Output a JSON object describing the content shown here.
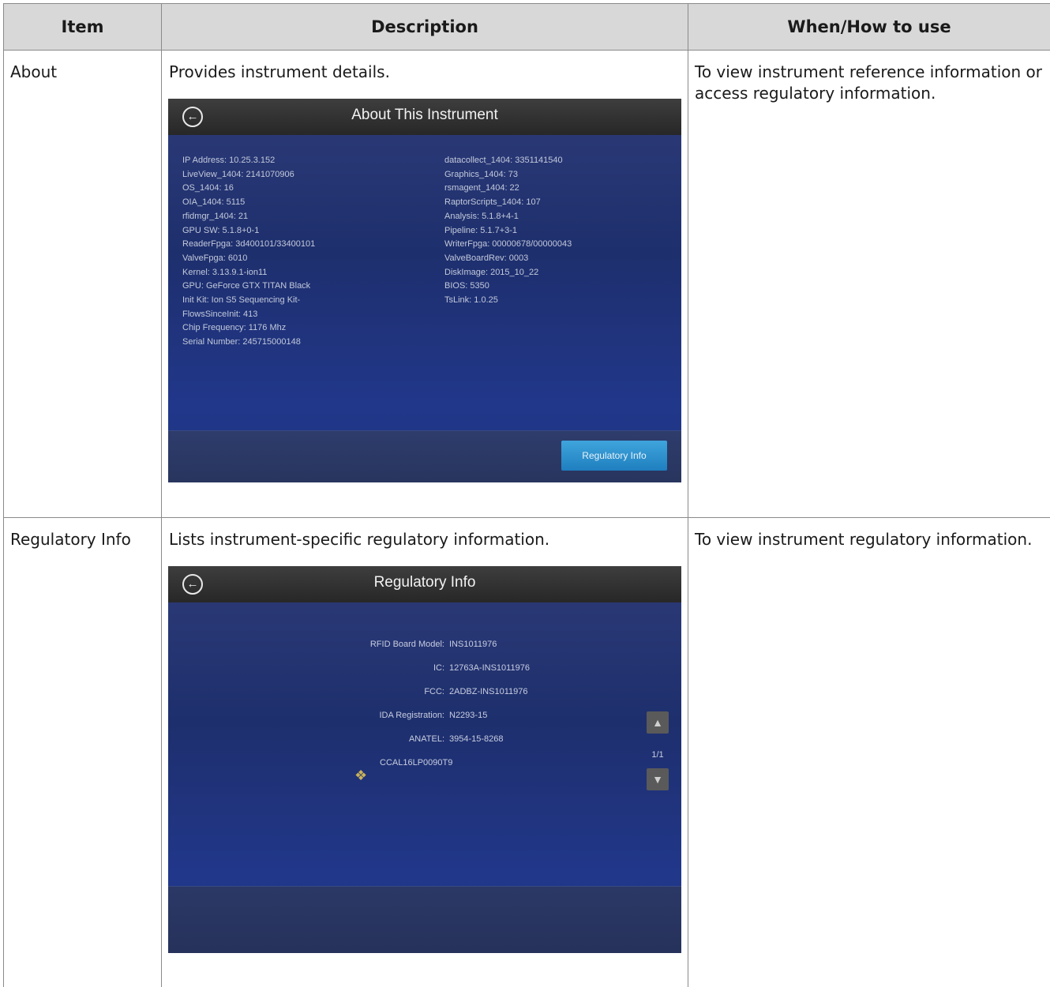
{
  "table": {
    "headers": [
      "Item",
      "Description",
      "When/How to use"
    ],
    "rows": [
      {
        "item": "About",
        "description": "Provides instrument details.",
        "usage": "To view instrument reference information or access regulatory information."
      },
      {
        "item": "Regulatory Info",
        "description": "Lists instrument-specific regulatory information.",
        "usage": "To view instrument regulatory information."
      }
    ]
  },
  "about_screen": {
    "title": "About This Instrument",
    "left_lines": [
      "IP Address: 10.25.3.152",
      "LiveView_1404: 2141070906",
      "OS_1404: 16",
      "OIA_1404: 5115",
      "rfidmgr_1404: 21",
      "GPU SW: 5.1.8+0-1",
      "ReaderFpga: 3d400101/33400101",
      "ValveFpga: 6010",
      "Kernel: 3.13.9.1-ion11",
      "GPU: GeForce GTX TITAN Black",
      "Init Kit: Ion S5 Sequencing Kit-",
      "FlowsSinceInit: 413",
      "Chip Frequency: 1176 Mhz",
      "Serial Number: 245715000148"
    ],
    "right_lines": [
      "datacollect_1404: 3351141540",
      "Graphics_1404: 73",
      "rsmagent_1404: 22",
      "RaptorScripts_1404: 107",
      "Analysis: 5.1.8+4-1",
      "Pipeline: 5.1.7+3-1",
      "WriterFpga: 00000678/00000043",
      "ValveBoardRev: 0003",
      "DiskImage: 2015_10_22",
      "BIOS: 5350",
      "TsLink: 1.0.25"
    ],
    "button_label": "Regulatory Info"
  },
  "reg_screen": {
    "title": "Regulatory Info",
    "entries": [
      {
        "label": "RFID Board Model:",
        "value": "INS1011976"
      },
      {
        "label": "IC:",
        "value": "12763A-INS1011976"
      },
      {
        "label": "FCC:",
        "value": "2ADBZ-INS1011976"
      },
      {
        "label": "IDA Registration:",
        "value": "N2293-15"
      },
      {
        "label": "ANATEL:",
        "value": "3954-15-8268"
      }
    ],
    "ca_code": "CCAL16LP0090T9",
    "page_indicator": "1/1",
    "icons": {
      "back": "back-arrow-icon",
      "up": "chevron-up-icon",
      "down": "chevron-down-icon",
      "logo": "rcm-logo-icon"
    }
  }
}
